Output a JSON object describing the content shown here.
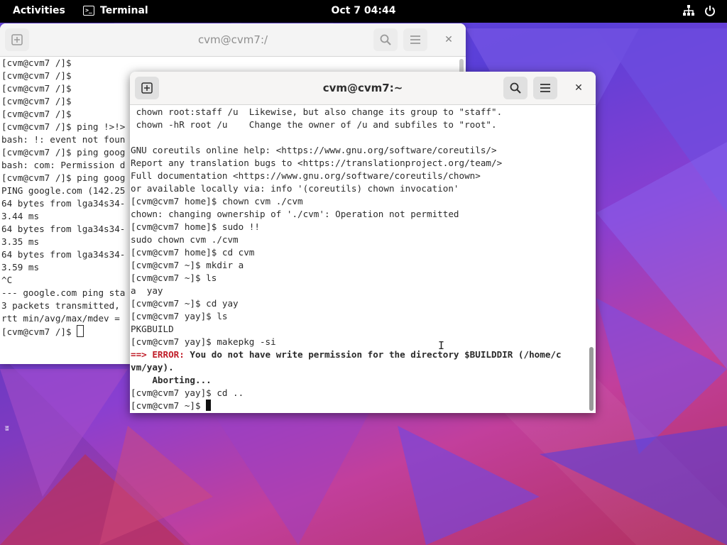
{
  "topbar": {
    "activities": "Activities",
    "app_name": "Terminal",
    "app_icon": "terminal-icon",
    "clock": "Oct 7  04:44",
    "tray_icons": [
      "network-icon",
      "power-icon"
    ]
  },
  "back_window": {
    "title": "cvm@cvm7:/",
    "lines": [
      "[cvm@cvm7 /]$",
      "[cvm@cvm7 /]$",
      "[cvm@cvm7 /]$",
      "[cvm@cvm7 /]$",
      "[cvm@cvm7 /]$",
      "[cvm@cvm7 /]$ ping !>!>",
      "bash: !: event not foun",
      "[cvm@cvm7 /]$ ping goog",
      "bash: com: Permission d",
      "[cvm@cvm7 /]$ ping goog",
      "PING google.com (142.25",
      "64 bytes from lga34s34-",
      "3.44 ms",
      "64 bytes from lga34s34-",
      "3.35 ms",
      "64 bytes from lga34s34-",
      "3.59 ms",
      "^C",
      "--- google.com ping sta",
      "3 packets transmitted,",
      "rtt min/avg/max/mdev =",
      "[cvm@cvm7 /]$ "
    ]
  },
  "front_window": {
    "title": "cvm@cvm7:~",
    "lines": [
      " chown root:staff /u  Likewise, but also change its group to \"staff\".",
      " chown -hR root /u    Change the owner of /u and subfiles to \"root\".",
      "",
      "GNU coreutils online help: <https://www.gnu.org/software/coreutils/>",
      "Report any translation bugs to <https://translationproject.org/team/>",
      "Full documentation <https://www.gnu.org/software/coreutils/chown>",
      "or available locally via: info '(coreutils) chown invocation'",
      "[cvm@cvm7 home]$ chown cvm ./cvm",
      "chown: changing ownership of './cvm': Operation not permitted",
      "[cvm@cvm7 home]$ sudo !!",
      "sudo chown cvm ./cvm",
      "[cvm@cvm7 home]$ cd cvm",
      "[cvm@cvm7 ~]$ mkdir a",
      "[cvm@cvm7 ~]$ ls",
      "a  yay",
      "[cvm@cvm7 ~]$ cd yay",
      "[cvm@cvm7 yay]$ ls",
      "PKGBUILD",
      "[cvm@cvm7 yay]$ makepkg -si"
    ],
    "error_prefix": "==> ERROR:",
    "error_text": " You do not have write permission for the directory $BUILDDIR (/home/c",
    "error_cont": "vm/yay).",
    "aborting": "    Aborting...",
    "after_lines": [
      "[cvm@cvm7 yay]$ cd .."
    ],
    "prompt": "[cvm@cvm7 ~]$ "
  },
  "desktop": {
    "mark": "ʬ"
  }
}
